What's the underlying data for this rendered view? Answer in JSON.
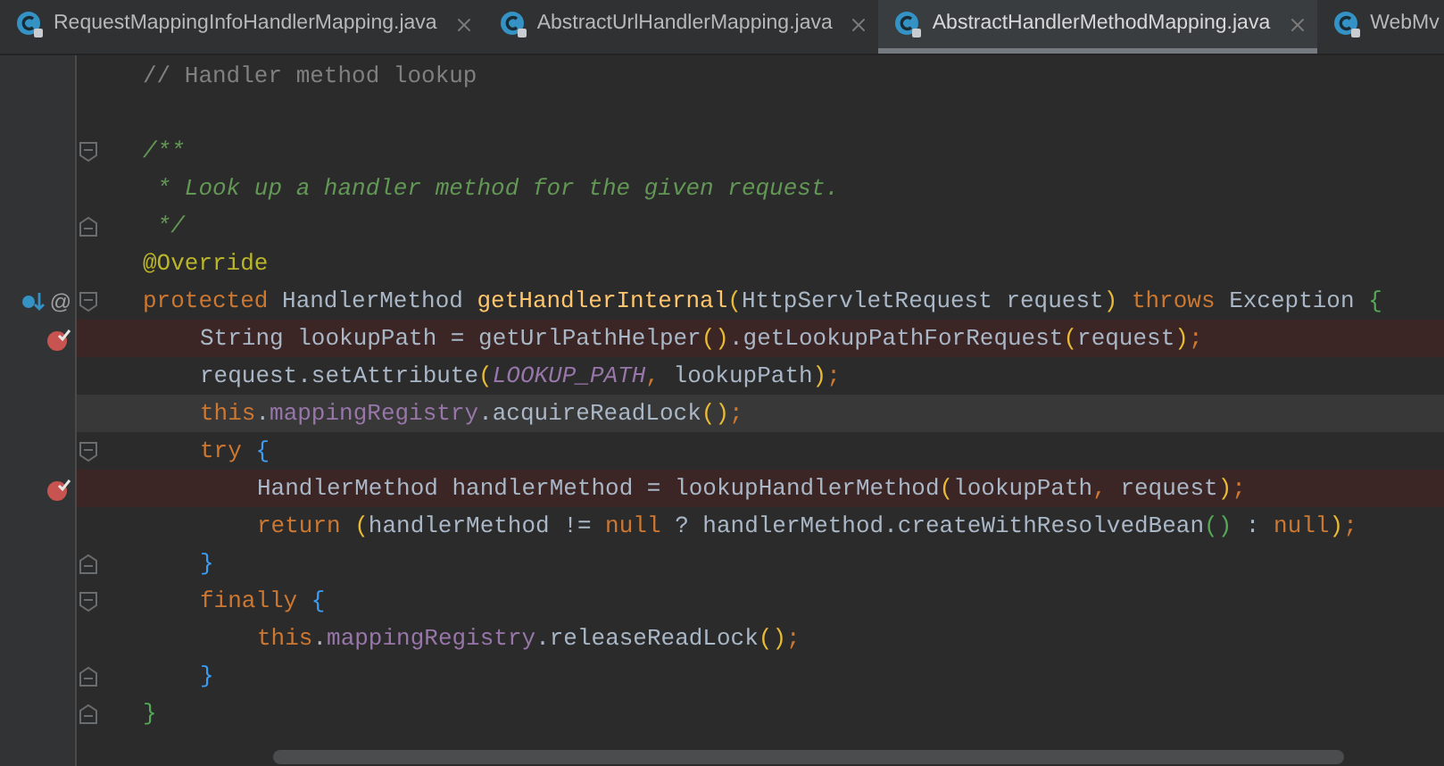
{
  "tabs": [
    {
      "label": "RequestMappingInfoHandlerMapping.java",
      "selected": false,
      "closable": true
    },
    {
      "label": "AbstractUrlHandlerMapping.java",
      "selected": false,
      "closable": true
    },
    {
      "label": "AbstractHandlerMethodMapping.java",
      "selected": true,
      "closable": true
    },
    {
      "label": "WebMv",
      "selected": false,
      "closable": false
    }
  ],
  "lines": [
    {
      "kind": "line",
      "breakpoint": false,
      "current": false,
      "tokens": [
        {
          "kind": "comment",
          "text": "// Handler method lookup"
        }
      ]
    },
    {
      "kind": "line",
      "breakpoint": false,
      "current": false
    },
    {
      "kind": "fold_start",
      "breakpoint": false,
      "current": false,
      "tokens": [
        {
          "kind": "doc",
          "text": "/**"
        }
      ]
    },
    {
      "kind": "line",
      "breakpoint": false,
      "current": false,
      "tokens": [
        {
          "kind": "doc",
          "text": " * Look up a handler method for the given request."
        }
      ]
    },
    {
      "kind": "fold_end",
      "breakpoint": false,
      "current": false,
      "tokens": [
        {
          "kind": "doc",
          "text": " */"
        }
      ]
    },
    {
      "kind": "line",
      "breakpoint": false,
      "current": false,
      "tokens": [
        {
          "kind": "annotation",
          "text": "@Override"
        }
      ]
    },
    {
      "kind": "fold_start",
      "breakpoint": false,
      "current": false,
      "overrides": true,
      "gutter_symbol": "@",
      "tokens": [
        {
          "kind": "keyword",
          "text": "protected "
        },
        {
          "kind": "plain",
          "text": "HandlerMethod "
        },
        {
          "kind": "method",
          "text": "getHandlerInternal"
        },
        {
          "kind": "paren",
          "text": "("
        },
        {
          "kind": "plain",
          "text": "HttpServletRequest request"
        },
        {
          "kind": "paren",
          "text": ")"
        },
        {
          "kind": "keyword",
          "text": " throws "
        },
        {
          "kind": "plain",
          "text": "Exception "
        },
        {
          "kind": "brace_green",
          "text": "{"
        }
      ],
      "children": [
        {
          "kind": "line",
          "breakpoint": true,
          "current": false,
          "tokens": [
            {
              "kind": "plain",
              "text": "String lookupPath = getUrlPathHelper"
            },
            {
              "kind": "paren",
              "text": "()"
            },
            {
              "kind": "plain",
              "text": ".getLookupPathForRequest"
            },
            {
              "kind": "paren",
              "text": "("
            },
            {
              "kind": "plain",
              "text": "request"
            },
            {
              "kind": "paren",
              "text": ")"
            },
            {
              "kind": "keyword",
              "text": ";"
            }
          ]
        },
        {
          "kind": "line",
          "breakpoint": false,
          "current": false,
          "tokens": [
            {
              "kind": "plain",
              "text": "request.setAttribute"
            },
            {
              "kind": "paren",
              "text": "("
            },
            {
              "kind": "constant",
              "text": "LOOKUP_PATH"
            },
            {
              "kind": "keyword",
              "text": ", "
            },
            {
              "kind": "plain",
              "text": "lookupPath"
            },
            {
              "kind": "paren",
              "text": ")"
            },
            {
              "kind": "keyword",
              "text": ";"
            }
          ]
        },
        {
          "kind": "line",
          "breakpoint": false,
          "current": true,
          "tokens": [
            {
              "kind": "keyword",
              "text": "this"
            },
            {
              "kind": "plain",
              "text": "."
            },
            {
              "kind": "field",
              "text": "mappingRegistry"
            },
            {
              "kind": "plain",
              "text": ".acquireReadLock"
            },
            {
              "kind": "paren",
              "text": "()"
            },
            {
              "kind": "keyword",
              "text": ";"
            }
          ]
        },
        {
          "kind": "fold_start",
          "breakpoint": false,
          "current": false,
          "tokens": [
            {
              "kind": "keyword",
              "text": "try "
            },
            {
              "kind": "brace_blue",
              "text": "{"
            }
          ],
          "children": [
            {
              "kind": "line",
              "breakpoint": true,
              "current": false,
              "tokens": [
                {
                  "kind": "plain",
                  "text": "HandlerMethod handlerMethod = lookupHandlerMethod"
                },
                {
                  "kind": "paren",
                  "text": "("
                },
                {
                  "kind": "plain",
                  "text": "lookupPath"
                },
                {
                  "kind": "keyword",
                  "text": ", "
                },
                {
                  "kind": "plain",
                  "text": "request"
                },
                {
                  "kind": "paren",
                  "text": ")"
                },
                {
                  "kind": "keyword",
                  "text": ";"
                }
              ]
            },
            {
              "kind": "line",
              "breakpoint": false,
              "current": false,
              "tokens": [
                {
                  "kind": "keyword",
                  "text": "return "
                },
                {
                  "kind": "paren",
                  "text": "("
                },
                {
                  "kind": "plain",
                  "text": "handlerMethod != "
                },
                {
                  "kind": "keyword",
                  "text": "null"
                },
                {
                  "kind": "plain",
                  "text": " ? handlerMethod.createWithResolvedBean"
                },
                {
                  "kind": "paren_green",
                  "text": "()"
                },
                {
                  "kind": "plain",
                  "text": " : "
                },
                {
                  "kind": "keyword",
                  "text": "null"
                },
                {
                  "kind": "paren",
                  "text": ")"
                },
                {
                  "kind": "keyword",
                  "text": ";"
                }
              ]
            }
          ]
        },
        {
          "kind": "fold_end",
          "breakpoint": false,
          "current": false,
          "tokens": [
            {
              "kind": "brace_blue",
              "text": "}"
            }
          ]
        },
        {
          "kind": "fold_start",
          "breakpoint": false,
          "current": false,
          "tokens": [
            {
              "kind": "keyword",
              "text": "finally "
            },
            {
              "kind": "brace_blue",
              "text": "{"
            }
          ],
          "children": [
            {
              "kind": "line",
              "breakpoint": false,
              "current": false,
              "tokens": [
                {
                  "kind": "keyword",
                  "text": "this"
                },
                {
                  "kind": "plain",
                  "text": "."
                },
                {
                  "kind": "field",
                  "text": "mappingRegistry"
                },
                {
                  "kind": "plain",
                  "text": ".releaseReadLock"
                },
                {
                  "kind": "paren",
                  "text": "()"
                },
                {
                  "kind": "keyword",
                  "text": ";"
                }
              ]
            }
          ]
        },
        {
          "kind": "fold_end",
          "breakpoint": false,
          "current": false,
          "tokens": [
            {
              "kind": "brace_blue",
              "text": "}"
            }
          ]
        }
      ]
    },
    {
      "kind": "fold_end",
      "breakpoint": false,
      "current": false,
      "tokens": [
        {
          "kind": "brace_green",
          "text": "}"
        }
      ]
    }
  ]
}
